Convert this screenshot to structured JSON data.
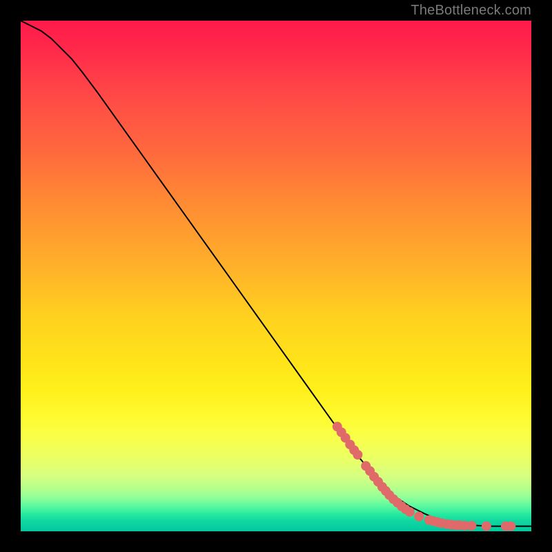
{
  "watermark": "TheBottleneck.com",
  "colors": {
    "dot": "#e06a6a",
    "line": "#000000"
  },
  "chart_data": {
    "type": "line",
    "title": "",
    "xlabel": "",
    "ylabel": "",
    "xlim": [
      0,
      100
    ],
    "ylim": [
      0,
      100
    ],
    "series": [
      {
        "name": "curve",
        "x": [
          0,
          2,
          4,
          6,
          8,
          10,
          12,
          15,
          20,
          25,
          30,
          35,
          40,
          45,
          50,
          55,
          60,
          65,
          70,
          73,
          76,
          79,
          81,
          83,
          84,
          86,
          88,
          90,
          92,
          94,
          96,
          98,
          100
        ],
        "y": [
          100,
          99,
          98,
          96.5,
          94.5,
          92.5,
          90,
          86,
          79,
          72,
          65,
          58,
          51,
          44,
          37,
          30,
          23,
          16,
          10,
          7,
          5,
          3.5,
          2.6,
          2.0,
          1.7,
          1.4,
          1.2,
          1.1,
          1.0,
          1.0,
          1.0,
          1.0,
          1.0
        ]
      }
    ],
    "markers": [
      {
        "x": 62.0,
        "y": 20.5
      },
      {
        "x": 62.8,
        "y": 19.4
      },
      {
        "x": 63.6,
        "y": 18.3
      },
      {
        "x": 64.5,
        "y": 17.0
      },
      {
        "x": 65.3,
        "y": 15.9
      },
      {
        "x": 66.0,
        "y": 15.0
      },
      {
        "x": 67.6,
        "y": 12.8
      },
      {
        "x": 68.4,
        "y": 11.8
      },
      {
        "x": 69.2,
        "y": 10.7
      },
      {
        "x": 70.0,
        "y": 9.7
      },
      {
        "x": 70.8,
        "y": 8.7
      },
      {
        "x": 71.5,
        "y": 7.9
      },
      {
        "x": 72.2,
        "y": 7.1
      },
      {
        "x": 73.0,
        "y": 6.3
      },
      {
        "x": 73.8,
        "y": 5.6
      },
      {
        "x": 74.6,
        "y": 4.9
      },
      {
        "x": 75.4,
        "y": 4.3
      },
      {
        "x": 76.2,
        "y": 3.8
      },
      {
        "x": 78.0,
        "y": 2.9
      },
      {
        "x": 80.0,
        "y": 2.2
      },
      {
        "x": 80.8,
        "y": 2.0
      },
      {
        "x": 81.6,
        "y": 1.8
      },
      {
        "x": 82.4,
        "y": 1.6
      },
      {
        "x": 83.5,
        "y": 1.4
      },
      {
        "x": 84.3,
        "y": 1.3
      },
      {
        "x": 85.2,
        "y": 1.2
      },
      {
        "x": 86.0,
        "y": 1.2
      },
      {
        "x": 87.0,
        "y": 1.1
      },
      {
        "x": 88.3,
        "y": 1.1
      },
      {
        "x": 91.2,
        "y": 1.0
      },
      {
        "x": 95.0,
        "y": 1.0
      },
      {
        "x": 96.0,
        "y": 1.0
      }
    ]
  }
}
